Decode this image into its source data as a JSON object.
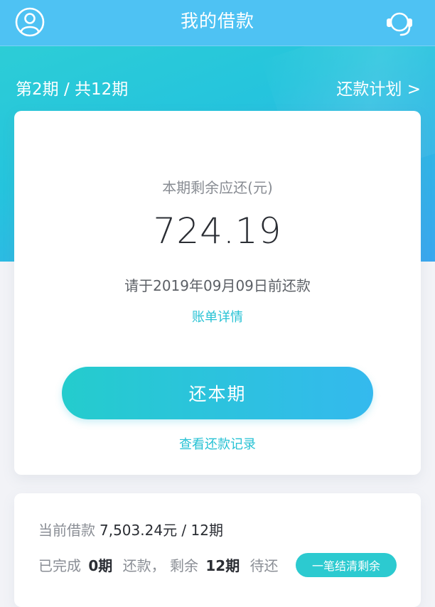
{
  "header": {
    "title": "我的借款"
  },
  "summary": {
    "period_text": "第2期 / 共12期",
    "plan_link": "还款计划 >"
  },
  "current_bill": {
    "label": "本期剩余应还(元)",
    "amount": "724.19",
    "due_text": "请于2019年09月09日前还款",
    "detail_link": "账单详情",
    "pay_button": "还本期",
    "record_link": "查看还款记录"
  },
  "loan": {
    "current_label": "当前借款",
    "current_value": "7,503.24元 / 12期",
    "completed_label": "已完成",
    "completed_value": "0期",
    "repaid_label": "还款，",
    "remaining_label": "剩余",
    "remaining_value": "12期",
    "pending_label": "待还",
    "settle_button": "一笔结清剩余"
  },
  "icons": {
    "left": "user-profile-icon",
    "right": "customer-service-headset-icon"
  },
  "colors": {
    "accent": "#27c2d4",
    "navbar": "#4ec2f3",
    "button_start": "#24cccd",
    "button_end": "#34b9ee"
  }
}
